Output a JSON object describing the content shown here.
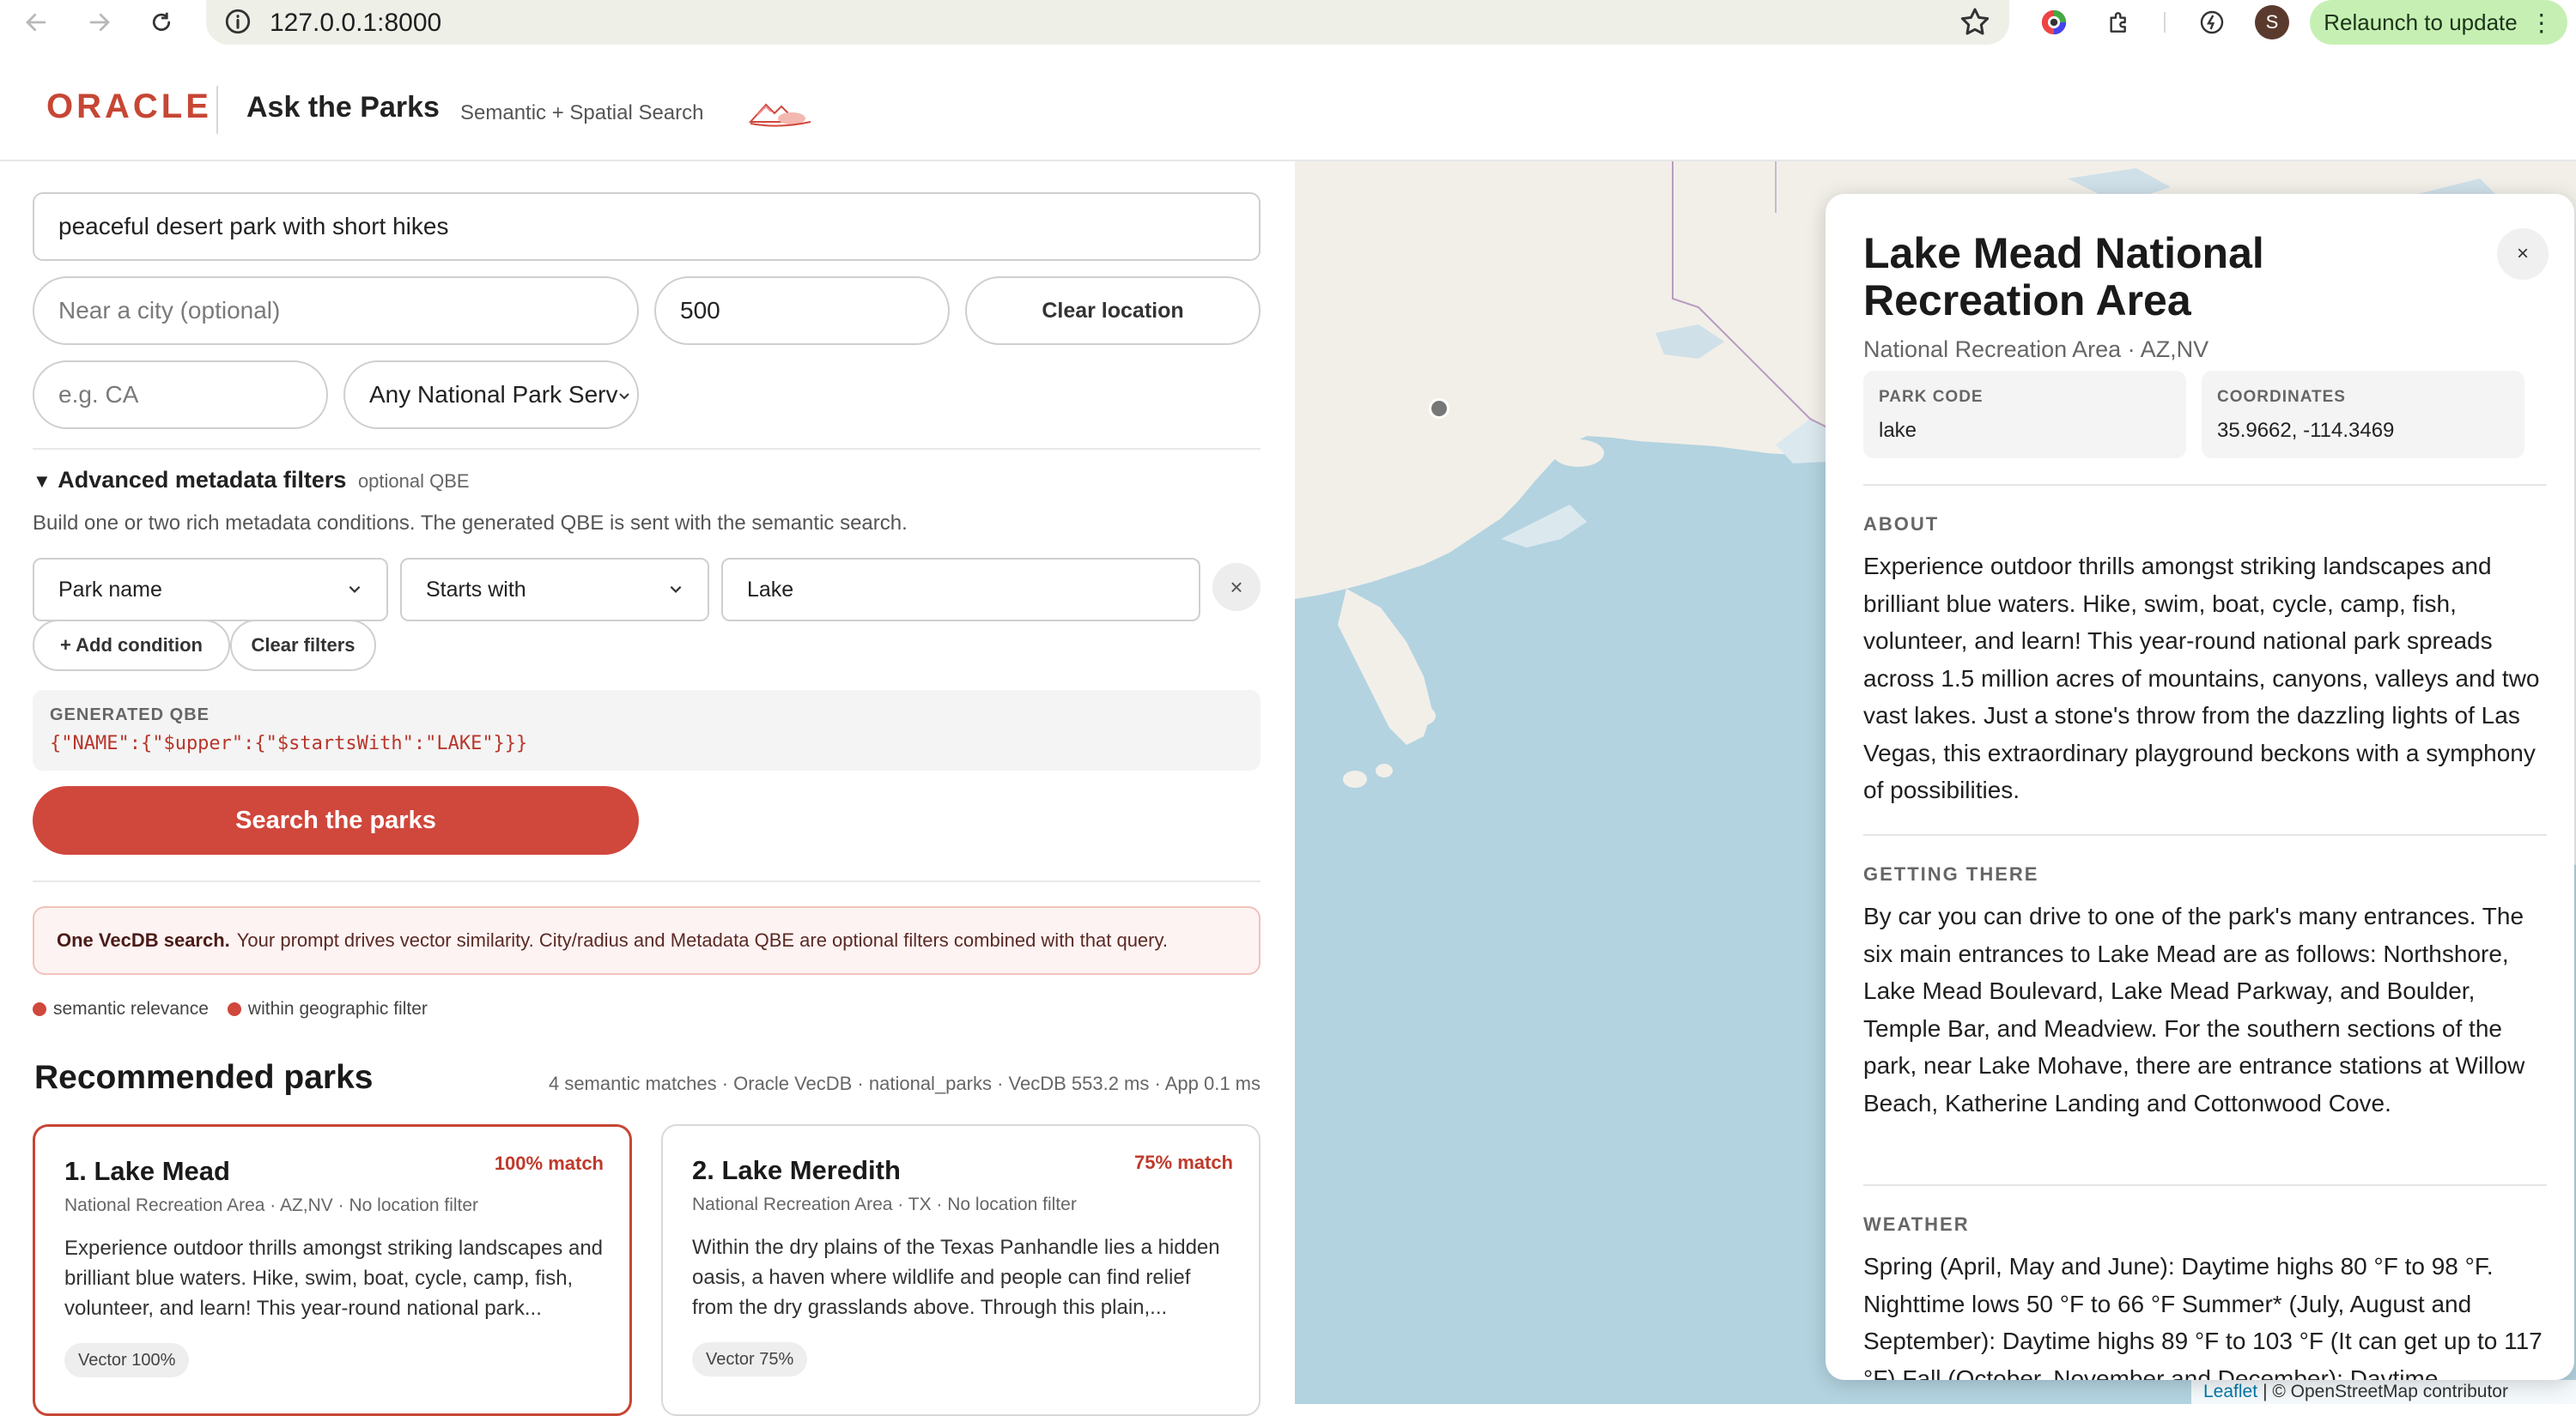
{
  "browser": {
    "url": "127.0.0.1:8000",
    "avatar_letter": "S",
    "relaunch_label": "Relaunch to update"
  },
  "header": {
    "brand": "ORACLE",
    "title": "Ask the Parks",
    "subtitle": "Semantic + Spatial Search"
  },
  "search": {
    "query": "peaceful desert park with short hikes",
    "city_placeholder": "Near a city (optional)",
    "radius": "500",
    "clear_location_label": "Clear location",
    "state_placeholder": "e.g. CA",
    "designation": "Any National Park Serv"
  },
  "advanced": {
    "title": "Advanced metadata filters",
    "optional_tag": "optional QBE",
    "description": "Build one or two rich metadata conditions. The generated QBE is sent with the semantic search.",
    "field": "Park name",
    "operator": "Starts with",
    "value": "Lake",
    "add_condition_label": "+ Add condition",
    "clear_filters_label": "Clear filters",
    "qbe_label": "GENERATED QBE",
    "qbe_code": "{\"NAME\":{\"$upper\":{\"$startsWith\":\"LAKE\"}}}"
  },
  "search_button_label": "Search the parks",
  "notice": {
    "bold": "One VecDB search.",
    "text": "Your prompt drives vector similarity. City/radius and Metadata QBE are optional filters combined with that query."
  },
  "legend": [
    {
      "label": "semantic relevance",
      "color": "#d0473c"
    },
    {
      "label": "within geographic filter",
      "color": "#d0473c"
    }
  ],
  "results": {
    "title": "Recommended parks",
    "meta": "4 semantic matches · Oracle VecDB · national_parks · VecDB 553.2 ms · App 0.1 ms",
    "cards": [
      {
        "name": "1. Lake Mead",
        "match": "100% match",
        "sub": "National Recreation Area · AZ,NV · No location filter",
        "desc": "Experience outdoor thrills amongst striking landscapes and brilliant blue waters. Hike, swim, boat, cycle, camp, fish, volunteer, and learn! This year-round national park...",
        "chip": "Vector 100%"
      },
      {
        "name": "2. Lake Meredith",
        "match": "75% match",
        "sub": "National Recreation Area · TX · No location filter",
        "desc": "Within the dry plains of the Texas Panhandle lies a hidden oasis, a haven where wildlife and people can find relief from the dry grasslands above. Through this plain,...",
        "chip": "Vector 75%"
      }
    ]
  },
  "map": {
    "water_color": "#b3d3e0",
    "land_color": "#f2efe9",
    "attribution_leaflet": "Leaflet",
    "attribution_rest": "| © OpenStreetMap contributor"
  },
  "detail": {
    "close_label": "×",
    "title": "Lake Mead National Recreation Area",
    "subtitle": "National Recreation Area · AZ,NV",
    "park_code_label": "PARK CODE",
    "park_code": "lake",
    "coords_label": "COORDINATES",
    "coords": "35.9662, -114.3469",
    "about_h": "ABOUT",
    "about": "Experience outdoor thrills amongst striking landscapes and brilliant blue waters. Hike, swim, boat, cycle, camp, fish, volunteer, and learn! This year-round national park spreads across 1.5 million acres of mountains, canyons, valleys and two vast lakes. Just a stone's throw from the dazzling lights of Las Vegas, this extraordinary playground beckons with a symphony of possibilities.",
    "getting_h": "GETTING THERE",
    "getting": "By car you can drive to one of the park's many entrances. The six main entrances to Lake Mead are as follows: Northshore, Lake Mead Boulevard, Lake Mead Parkway, and Boulder, Temple Bar, and Meadview. For the southern sections of the park, near Lake Mohave, there are entrance stations at Willow Beach, Katherine Landing and Cottonwood Cove.",
    "weather_h": "WEATHER",
    "weather": "Spring (April, May and June): Daytime highs 80 °F to 98 °F. Nighttime lows 50 °F to 66 °F Summer* (July, August and September): Daytime highs 89 °F to 103 °F (It can get up to 117 °F) Fall (October, November and December): Daytime"
  },
  "zoom": {
    "in": "+",
    "out": "−"
  }
}
